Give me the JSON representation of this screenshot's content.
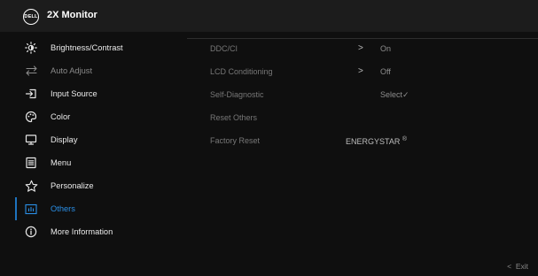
{
  "header": {
    "logo_text": "DELL",
    "title": "2X Monitor"
  },
  "menu": [
    {
      "id": "brightness-contrast",
      "icon": "brightness-icon",
      "label": "Brightness/Contrast",
      "state": "normal"
    },
    {
      "id": "auto-adjust",
      "icon": "auto-adjust-icon",
      "label": "Auto Adjust",
      "state": "disabled"
    },
    {
      "id": "input-source",
      "icon": "input-source-icon",
      "label": "Input Source",
      "state": "normal"
    },
    {
      "id": "color",
      "icon": "color-palette-icon",
      "label": "Color",
      "state": "normal"
    },
    {
      "id": "display",
      "icon": "display-icon",
      "label": "Display",
      "state": "normal"
    },
    {
      "id": "menu",
      "icon": "menu-icon",
      "label": "Menu",
      "state": "normal"
    },
    {
      "id": "personalize",
      "icon": "star-icon",
      "label": "Personalize",
      "state": "normal"
    },
    {
      "id": "others",
      "icon": "others-icon",
      "label": "Others",
      "state": "selected"
    },
    {
      "id": "more-information",
      "icon": "info-icon",
      "label": "More Information",
      "state": "normal"
    }
  ],
  "submenu": [
    {
      "label": "DDC/CI",
      "has_arrow": true,
      "arrow": ">",
      "value": "On"
    },
    {
      "label": "LCD Conditioning",
      "has_arrow": true,
      "arrow": ">",
      "value": "Off"
    },
    {
      "label": "Self-Diagnostic",
      "has_arrow": false,
      "arrow": "",
      "value": "Select",
      "value_suffix": "✓"
    },
    {
      "label": "Reset Others",
      "has_arrow": false,
      "arrow": "",
      "value": ""
    },
    {
      "label": "Factory Reset",
      "has_arrow": false,
      "arrow": "",
      "value": "ENERGYSTAR",
      "value_sup": "®"
    }
  ],
  "footer": {
    "exit_arrow": "<",
    "exit_label": "Exit"
  },
  "colors": {
    "accent": "#2a8fe6",
    "background": "#0f0f0f",
    "header": "#1c1c1c",
    "text": "#eaeaea",
    "disabled": "#8a8a8a"
  }
}
